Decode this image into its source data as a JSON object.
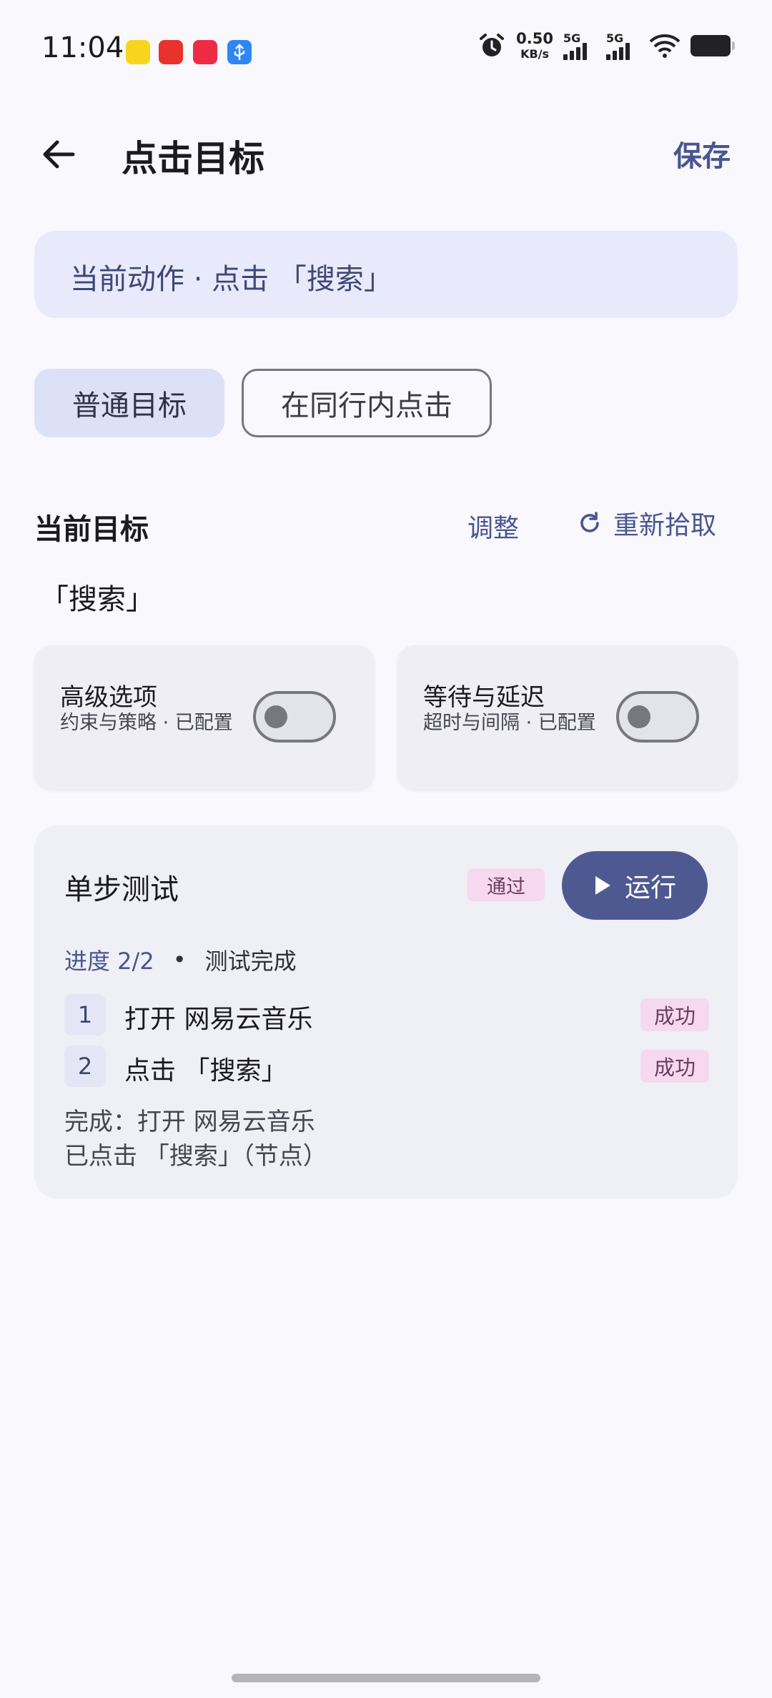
{
  "status_bar": {
    "time": "11:04",
    "net_speed_value": "0.50",
    "net_speed_unit": "KB/s",
    "signal1_label": "5G",
    "signal2_label": "5G",
    "icons": [
      "notification-app-yellow-icon",
      "notification-app-red-icon",
      "notification-xiaohongshu-icon",
      "usb-icon",
      "alarm-icon",
      "wifi-icon",
      "battery-icon"
    ]
  },
  "header": {
    "title": "点击目标",
    "save_label": "保存"
  },
  "current_action": "当前动作 · 点击 「搜索」",
  "mode_chips": [
    {
      "label": "普通目标",
      "selected": true
    },
    {
      "label": "在同行内点击",
      "selected": false
    }
  ],
  "target_section": {
    "title": "当前目标",
    "adjust_label": "调整",
    "repick_label": "重新拾取",
    "target_value": "「搜索」"
  },
  "option_cards": [
    {
      "title": "高级选项",
      "subtitle": "约束与策略 · 已配置",
      "enabled": false
    },
    {
      "title": "等待与延迟",
      "subtitle": "超时与间隔 · 已配置",
      "enabled": false
    }
  ],
  "single_step_test": {
    "title": "单步测试",
    "badge": "通过",
    "run_label": "运行",
    "progress_label": "进度 2/2",
    "separator": "•",
    "status": "测试完成",
    "steps": [
      {
        "index": "1",
        "text": "打开 网易云音乐",
        "result": "成功"
      },
      {
        "index": "2",
        "text": "点击 「搜索」",
        "result": "成功"
      }
    ],
    "result_line1": "完成：打开 网易云音乐",
    "result_line2": "已点击 「搜索」（节点）"
  },
  "colors": {
    "accent": "#4a5590",
    "run_button": "#4f5991",
    "badge_bg": "#f6d8ef",
    "action_bg": "#e8eafb",
    "background": "#f8f8fd"
  }
}
